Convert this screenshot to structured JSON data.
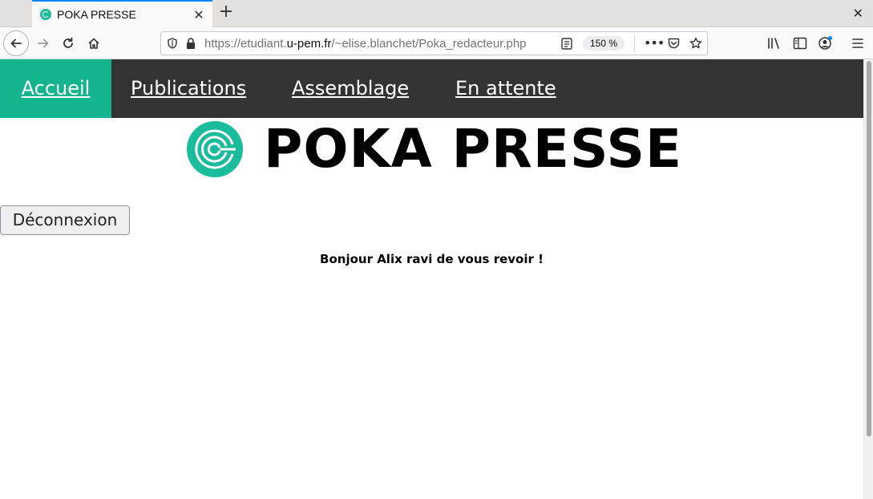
{
  "browser": {
    "tab_title": "POKA PRESSE",
    "url_prefix": "https://etudiant.",
    "url_host": "u-pem.fr",
    "url_path": "/~elise.blanchet/Poka_redacteur.php",
    "zoom": "150 %",
    "icons": {
      "back": "back-arrow-icon",
      "forward": "forward-arrow-icon",
      "reload": "reload-icon",
      "home": "home-icon",
      "close_tab": "close-icon",
      "new_tab": "plus-icon",
      "close_window": "close-icon",
      "tracking": "shield-icon",
      "secure": "lock-icon",
      "reader": "reader-view-icon",
      "more": "more-icon",
      "pocket": "pocket-icon",
      "bookmark": "star-icon",
      "library": "library-icon",
      "sidebar": "sidebar-icon",
      "account": "account-icon",
      "menu": "hamburger-menu-icon"
    }
  },
  "site": {
    "nav": {
      "home": "Accueil",
      "publications": "Publications",
      "assemblage": "Assemblage",
      "pending": "En attente"
    },
    "brand_name": "POKA PRESSE",
    "logout_label": "Déconnexion",
    "greeting": "Bonjour Alix ravi de vous revoir !"
  },
  "colors": {
    "nav_background": "#333333",
    "nav_active": "#14b48c",
    "logo": "#1abc9c",
    "browser_accent": "#0a84ff"
  }
}
